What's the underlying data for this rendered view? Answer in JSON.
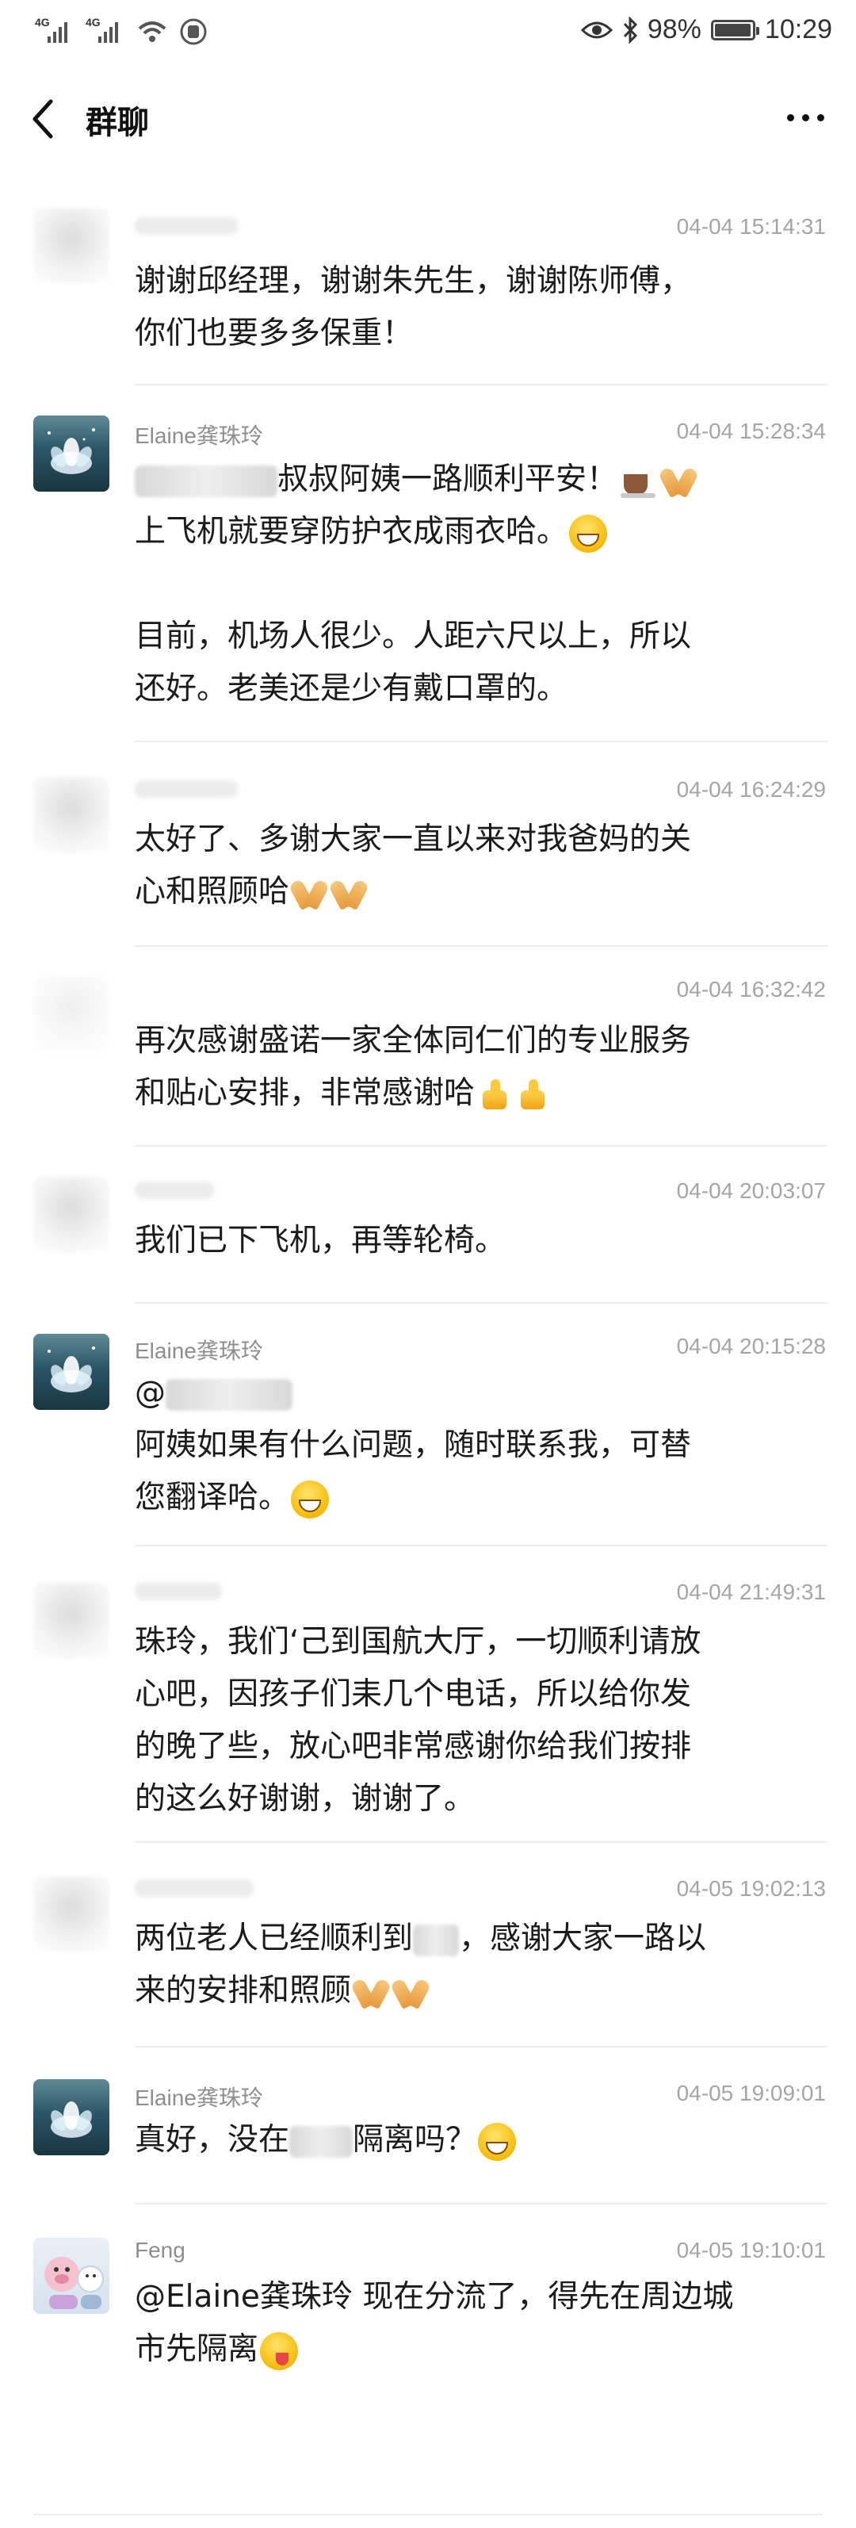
{
  "status_bar": {
    "sim1": "4G",
    "sim2": "4G",
    "battery_pct": "98%",
    "battery_level": 0.98,
    "time": "10:29",
    "icons": [
      "eye-icon",
      "bluetooth-icon",
      "wifi-icon",
      "battery-icon"
    ]
  },
  "nav": {
    "title": "群聊"
  },
  "messages": [
    {
      "sender": "",
      "time": "04-04 15:14:31",
      "lines": [
        "谢谢邱经理，谢谢朱先生，谢谢陈师傅，",
        "你们也要多多保重！"
      ]
    },
    {
      "sender": "Elaine龚珠玲",
      "time": "04-04 15:28:34",
      "lines": [
        "叔叔阿姨一路顺利平安！",
        "上飞机就要穿防护衣成雨衣哈。",
        "",
        "目前，机场人很少。人距六尺以上，所以",
        "还好。老美还是少有戴口罩的。"
      ]
    },
    {
      "sender": "",
      "time": "04-04 16:24:29",
      "lines": [
        "太好了、多谢大家一直以来对我爸妈的关",
        "心和照顾哈"
      ]
    },
    {
      "sender": "",
      "time": "04-04 16:32:42",
      "lines": [
        "再次感谢盛诺一家全体同仁们的专业服务",
        "和贴心安排，非常感谢哈"
      ]
    },
    {
      "sender": "",
      "time": "04-04 20:03:07",
      "lines": [
        "我们已下飞机，再等轮椅。"
      ]
    },
    {
      "sender": "Elaine龚珠玲",
      "time": "04-04 20:15:28",
      "lines": [
        "@",
        "阿姨如果有什么问题，随时联系我，可替",
        "您翻译哈。"
      ]
    },
    {
      "sender": "",
      "time": "04-04 21:49:31",
      "lines": [
        "珠玲，我们‘己到国航大厅，一切顺利请放",
        "心吧，因孩子们耒几个电话，所以给你发",
        "的晚了些，放心吧非常感谢你给我们按排",
        "的这么好谢谢，谢谢了。"
      ]
    },
    {
      "sender": "",
      "time": "04-05 19:02:13",
      "lines": [
        "两位老人已经顺利到",
        "，感谢大家一路以",
        "来的安排和照顾"
      ]
    },
    {
      "sender": "Elaine龚珠玲",
      "time": "04-05 19:09:01",
      "lines": [
        "真好，没在",
        "隔离吗？"
      ]
    },
    {
      "sender": "Feng",
      "time": "04-05 19:10:01",
      "lines": [
        "@Elaine龚珠玲 现在分流了，得先在周边城",
        "市先隔离"
      ]
    }
  ]
}
